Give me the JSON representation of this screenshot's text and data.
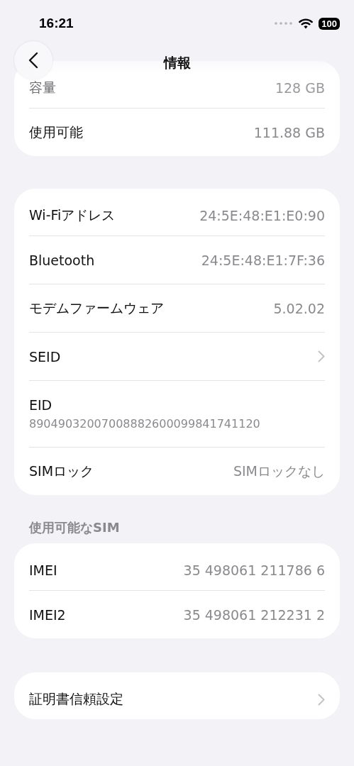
{
  "status_bar": {
    "time": "16:21",
    "battery": "100"
  },
  "nav": {
    "title": "情報"
  },
  "groups": [
    {
      "rows": [
        {
          "kind": "value",
          "label": "容量",
          "value": "128 GB",
          "faded": true
        },
        {
          "kind": "value",
          "label": "使用可能",
          "value": "111.88 GB",
          "faded": false
        }
      ]
    },
    {
      "rows": [
        {
          "kind": "value",
          "label": "Wi-Fiアドレス",
          "value": "24:5E:48:E1:E0:90",
          "faded": false
        },
        {
          "kind": "value",
          "label": "Bluetooth",
          "value": "24:5E:48:E1:7F:36",
          "faded": false
        },
        {
          "kind": "value",
          "label": "モデムファームウェア",
          "value": "5.02.02",
          "faded": false
        },
        {
          "kind": "chevron",
          "label": "SEID",
          "faded": false
        },
        {
          "kind": "stacked",
          "label": "EID",
          "value": "89049032007008882600099841741120",
          "faded": false
        },
        {
          "kind": "value",
          "label": "SIMロック",
          "value": "SIMロックなし",
          "faded": false
        }
      ]
    },
    {
      "header": "使用可能なSIM",
      "rows": [
        {
          "kind": "value",
          "label": "IMEI",
          "value": "35 498061 211786 6",
          "faded": false
        },
        {
          "kind": "value",
          "label": "IMEI2",
          "value": "35 498061 212231 2",
          "faded": false
        }
      ]
    },
    {
      "rows": [
        {
          "kind": "chevron",
          "label": "証明書信頼設定",
          "faded": false
        }
      ]
    }
  ]
}
